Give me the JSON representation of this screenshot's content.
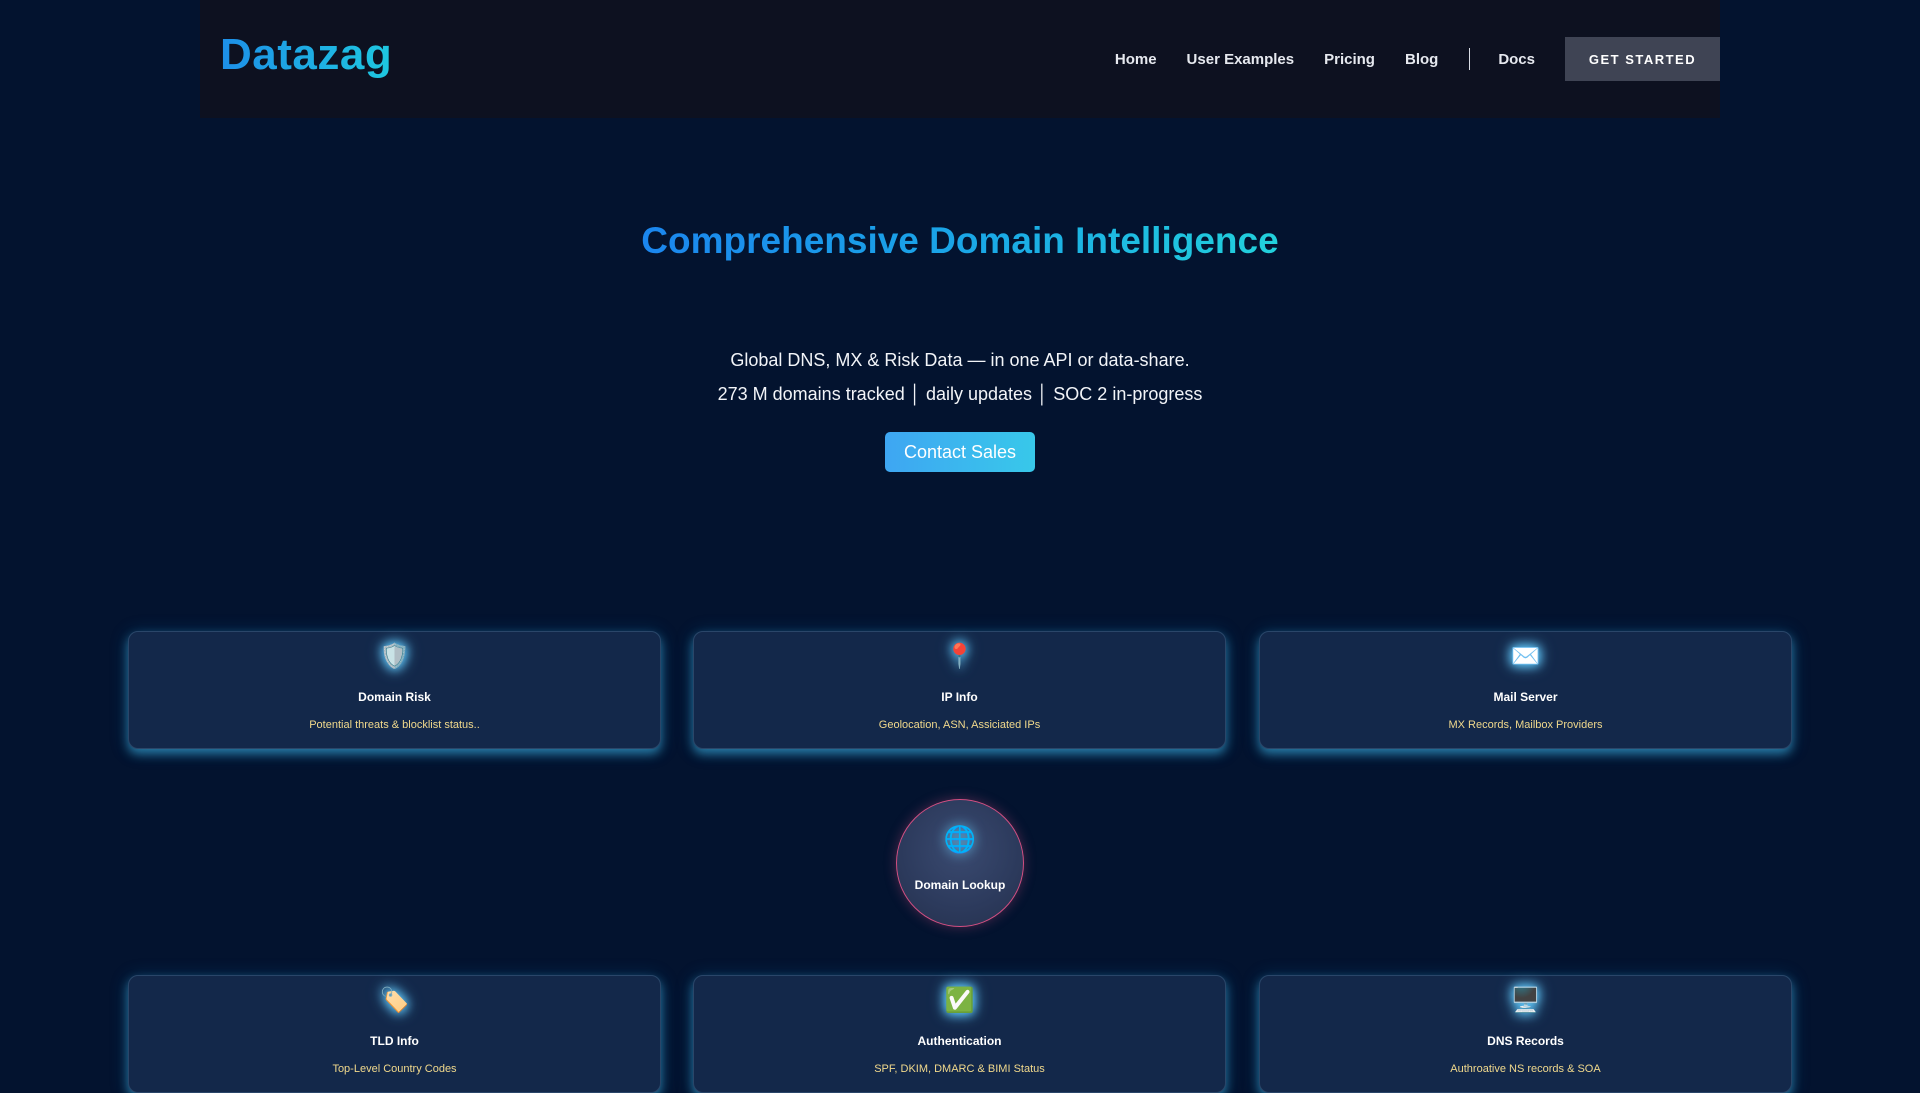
{
  "header": {
    "logo": "Datazag",
    "nav": [
      "Home",
      "User Examples",
      "Pricing",
      "Blog"
    ],
    "docs_label": "Docs",
    "cta_label": "GET STARTED"
  },
  "hero": {
    "title": "Comprehensive Domain Intelligence",
    "subtitle": "Global DNS, MX & Risk Data — in one API or data-share.",
    "stats": "273 M domains tracked │ daily updates │ SOC 2 in-progress",
    "contact_label": "Contact Sales"
  },
  "cards": [
    {
      "icon": "🛡️",
      "icon_name": "shield-icon",
      "title": "Domain Risk",
      "desc": "Potential threats & blocklist status.."
    },
    {
      "icon": "📍",
      "icon_name": "map-pin-icon",
      "title": "IP Info",
      "desc": "Geolocation, ASN, Assiciated IPs"
    },
    {
      "icon": "✉️",
      "icon_name": "envelope-icon",
      "title": "Mail Server",
      "desc": "MX Records, Mailbox Providers"
    },
    {
      "icon": "🏷️",
      "icon_name": "tag-icon",
      "title": "TLD Info",
      "desc": "Top-Level Country Codes"
    },
    {
      "icon": "✅",
      "icon_name": "check-mark-icon",
      "title": "Authentication",
      "desc": "SPF, DKIM, DMARC & BIMI Status"
    },
    {
      "icon": "🖥️",
      "icon_name": "monitor-icon",
      "title": "DNS Records",
      "desc": "Authroative NS records & SOA"
    }
  ],
  "lookup": {
    "icon": "🌐",
    "icon_name": "globe-icon",
    "title": "Domain Lookup",
    "border_color": "#d24f82"
  },
  "colors": {
    "background": "#03132f",
    "accent": "#1ea5e6",
    "card_bg": "#13284a",
    "card_desc": "#f1d98c"
  }
}
